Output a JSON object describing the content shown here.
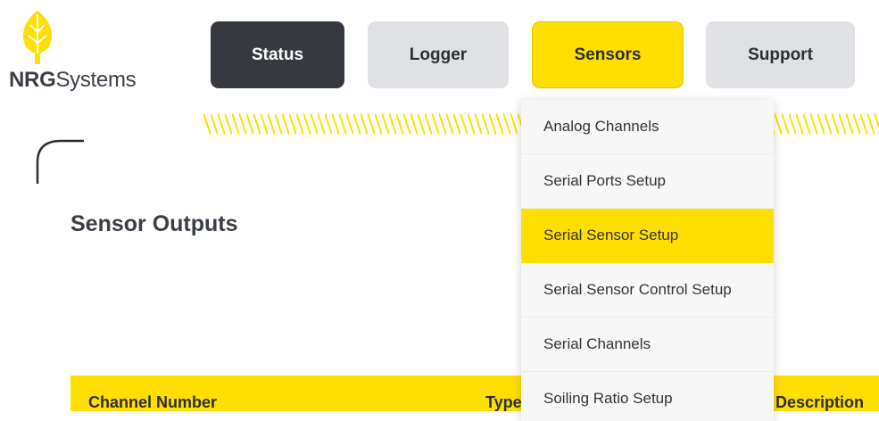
{
  "logo": {
    "bold": "NRG",
    "regular": "Systems"
  },
  "nav": [
    {
      "label": "Status"
    },
    {
      "label": "Logger"
    },
    {
      "label": "Sensors"
    },
    {
      "label": "Support"
    }
  ],
  "page": {
    "title": "Sensor Outputs"
  },
  "table": {
    "headers": [
      "Channel Number",
      "Type",
      "Description"
    ]
  },
  "dropdown": {
    "items": [
      {
        "label": "Analog Channels"
      },
      {
        "label": "Serial Ports Setup"
      },
      {
        "label": "Serial Sensor Setup"
      },
      {
        "label": "Serial Sensor Control Setup"
      },
      {
        "label": "Serial Channels"
      },
      {
        "label": "Soiling Ratio Setup"
      }
    ]
  },
  "colors": {
    "accent": "#ffdf00",
    "dark": "#363940",
    "light": "#dfe1e5"
  }
}
